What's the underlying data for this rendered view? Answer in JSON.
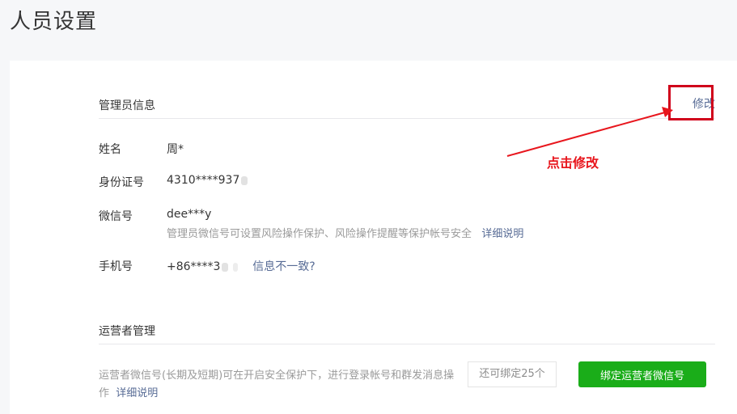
{
  "page": {
    "title": "人员设置"
  },
  "admin": {
    "section_title": "管理员信息",
    "edit_label": "修改",
    "name_label": "姓名",
    "name_value": "周*",
    "id_label": "身份证号",
    "id_value": "4310****937",
    "wechat_label": "微信号",
    "wechat_value": "dee***y",
    "wechat_hint": "管理员微信号可设置风险操作保护、风险操作提醒等保护帐号安全",
    "wechat_hint_link": "详细说明",
    "phone_label": "手机号",
    "phone_value": "+86****3",
    "phone_mismatch_link": "信息不一致?"
  },
  "annotation": {
    "text": "点击修改",
    "color": "#e8161d"
  },
  "operator": {
    "section_title": "运营者管理",
    "description": "运营者微信号(长期及短期)可在开启安全保护下，进行登录帐号和群发消息操作",
    "description_link": "详细说明",
    "remaining_label": "还可绑定25个",
    "bind_button_label": "绑定运营者微信号"
  },
  "colors": {
    "link": "#576b95",
    "primary_button": "#1aad19",
    "highlight_border": "#d0021b"
  }
}
